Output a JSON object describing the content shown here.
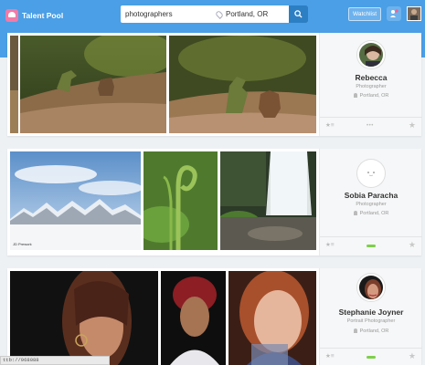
{
  "app": {
    "brand": "Talent Pool",
    "search": {
      "query": "photographers",
      "location": "Portland, OR"
    },
    "watchlist_label": "Watchlist"
  },
  "profiles": [
    {
      "name": "Rebecca",
      "role": "Photographer",
      "location": "Portland, OR",
      "left_count": "★≡",
      "status": "dots"
    },
    {
      "name": "Sobia Paracha",
      "role": "Photographer",
      "location": "Portland, OR",
      "left_count": "★≡",
      "status": "online"
    },
    {
      "name": "Stephanie Joyner",
      "role": "Portrait Photographer",
      "location": "Portland, OR",
      "left_count": "★≡",
      "status": "online"
    }
  ],
  "status_url": "ttb://968088",
  "photo_captions": {
    "mountain_credit": "JD Prework"
  },
  "colors": {
    "topbar": "#4a9fe6",
    "search_button": "#2d7fc4",
    "online": "#7ecf4a"
  },
  "status_dots": "•••"
}
